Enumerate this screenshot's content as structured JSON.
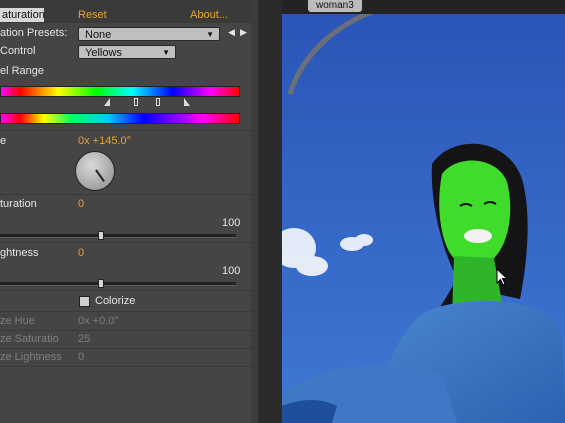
{
  "panel": {
    "tab_label": "aturation",
    "reset_label": "Reset",
    "about_label": "About...",
    "presets_label": "ation Presets:",
    "presets_value": "None",
    "channel_control_label": "Control",
    "channel_control_value": "Yellows",
    "channel_range_label": "el Range",
    "hue_label": "e",
    "hue_value": "0x +145.0°",
    "saturation_label": "turation",
    "saturation_value": "0",
    "saturation_max": "100",
    "lightness_label": "ghtness",
    "lightness_value": "0",
    "lightness_max": "100",
    "colorize_label": "Colorize",
    "colorize_hue_label": "ze Hue",
    "colorize_hue_value": "0x +0.0°",
    "colorize_saturation_label": "ze Saturatio",
    "colorize_saturation_value": "25",
    "colorize_lightness_label": "ze Lightness",
    "colorize_lightness_value": "0"
  },
  "viewer": {
    "tab_label": "woman3"
  },
  "icons": {
    "prev_preset": "triangle-left-icon",
    "next_preset": "triangle-right-icon",
    "cursor": "mouse-pointer-icon"
  },
  "colors": {
    "accent": "#e8a52c",
    "panel_bg": "#454545",
    "sky": "#2e5fc2",
    "sweater": "#3f78c4",
    "hair": "#141416",
    "skin": "#3fdc2c"
  }
}
